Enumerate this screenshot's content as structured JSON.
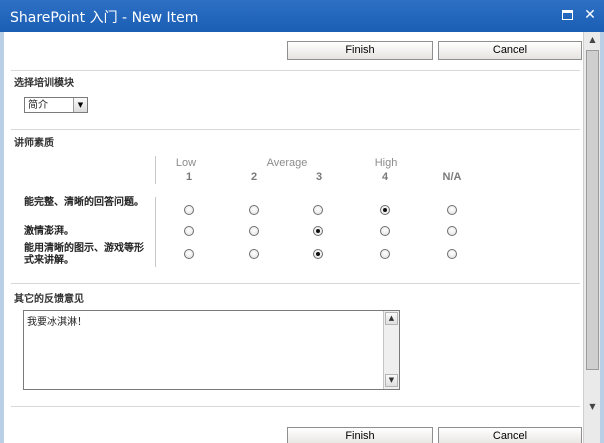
{
  "window": {
    "title": "SharePoint 入门 - New Item",
    "close_glyph": "✕"
  },
  "toolbar": {
    "finish_label": "Finish",
    "cancel_label": "Cancel"
  },
  "module": {
    "label": "选择培训模块",
    "selected": "简介"
  },
  "rating": {
    "label": "讲师素质",
    "scale_labels": {
      "low": "Low",
      "average": "Average",
      "high": "High"
    },
    "columns": [
      "1",
      "2",
      "3",
      "4",
      "N/A"
    ],
    "questions": [
      {
        "text": "能完整、清晰的回答问题。",
        "selected": "4"
      },
      {
        "text": "激情澎湃。",
        "selected": "3"
      },
      {
        "text": "能用清晰的图示、游戏等形式来讲解。",
        "selected": "3"
      }
    ]
  },
  "feedback": {
    "label": "其它的反馈意见",
    "value": "我要冰淇淋！"
  },
  "bottom_toolbar": {
    "finish_label": "Finish",
    "cancel_label": "Cancel"
  }
}
